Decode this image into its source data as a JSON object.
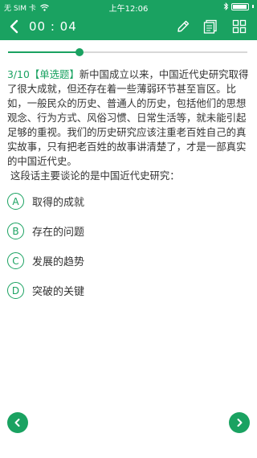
{
  "status_bar": {
    "carrier": "无 SIM 卡",
    "time": "上午12:06",
    "battery_level": 0.95
  },
  "toolbar": {
    "timer": "00 : 04",
    "icons": [
      "back-arrow-icon",
      "pencil-icon",
      "answer-card-icon",
      "grid-icon"
    ]
  },
  "progress": {
    "current": 3,
    "total": 10
  },
  "question": {
    "index": "3/10",
    "type": "【单选题】",
    "text": "新中国成立以来，中国近代史研究取得了很大成就，但还存在着一些薄弱环节甚至盲区。比如，一般民众的历史、普通人的历史，包括他们的思想观念、行为方式、风俗习惯、日常生活等，就未能引起足够的重视。我们的历史研究应该注重老百姓自己的真实故事，只有把老百姓的故事讲清楚了，才是一部真实的中国近代史。",
    "ask": "这段话主要谈论的是中国近代史研究："
  },
  "options": [
    {
      "letter": "A",
      "text": "取得的成就"
    },
    {
      "letter": "B",
      "text": "存在的问题"
    },
    {
      "letter": "C",
      "text": "发展的趋势"
    },
    {
      "letter": "D",
      "text": "突破的关键"
    }
  ],
  "colors": {
    "accent": "#1aa261",
    "text": "#333333",
    "track": "#d8d8d8"
  }
}
